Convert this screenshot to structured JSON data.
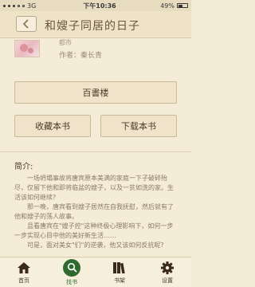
{
  "status": {
    "carrier": "3G",
    "time": "下午10:36",
    "battery": "49%",
    "battery_level": 0.49
  },
  "nav": {
    "title": "和嫂子同居的日子",
    "back_icon": "chevron-left-icon"
  },
  "book": {
    "meta_top": "都市",
    "author": "作者：秦长青"
  },
  "buttons": {
    "source": "百書楼",
    "collect": "收藏本书",
    "download": "下载本书"
  },
  "intro": {
    "label": "简介:",
    "text": "　　一场坍塌事故将唐宾原本美满的家庭一下子破碎殆尽，仅留下他和即将临盆的嫂子，以及一贫如洗的家。生活该如何继续?\n　　那一晚，唐宾看到嫂子居然在自我抚慰，然后就有了他和嫂子的荡人故事。\n　　且看唐宾在\"嫂子控\"这种终极心理影响下，如何一步一步实现心目中他的美好新生活……\n　　可是，面对美女\"们\"的逆袭，他又该如何反抗呢?"
  },
  "tabs": [
    {
      "label": "首页",
      "icon": "home-icon"
    },
    {
      "label": "找书",
      "icon": "search-icon",
      "active": true
    },
    {
      "label": "书架",
      "icon": "bookshelf-icon"
    },
    {
      "label": "设置",
      "icon": "gear-icon"
    }
  ],
  "colors": {
    "background": "#f4ecd6",
    "accent": "#2f6b2f",
    "text": "#5a4a3a"
  }
}
